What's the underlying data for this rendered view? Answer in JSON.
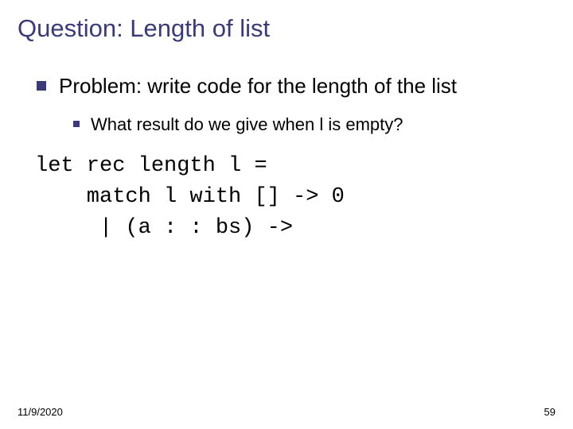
{
  "title": "Question: Length of list",
  "bullets": {
    "level1": "Problem: write code for the length of the list",
    "level2": "What result do we give when l is empty?"
  },
  "code": {
    "line1": "let rec length l =",
    "line2": "    match l with [] -> 0",
    "line3": "     | (a : : bs) ->"
  },
  "footer": {
    "date": "11/9/2020",
    "page": "59"
  }
}
